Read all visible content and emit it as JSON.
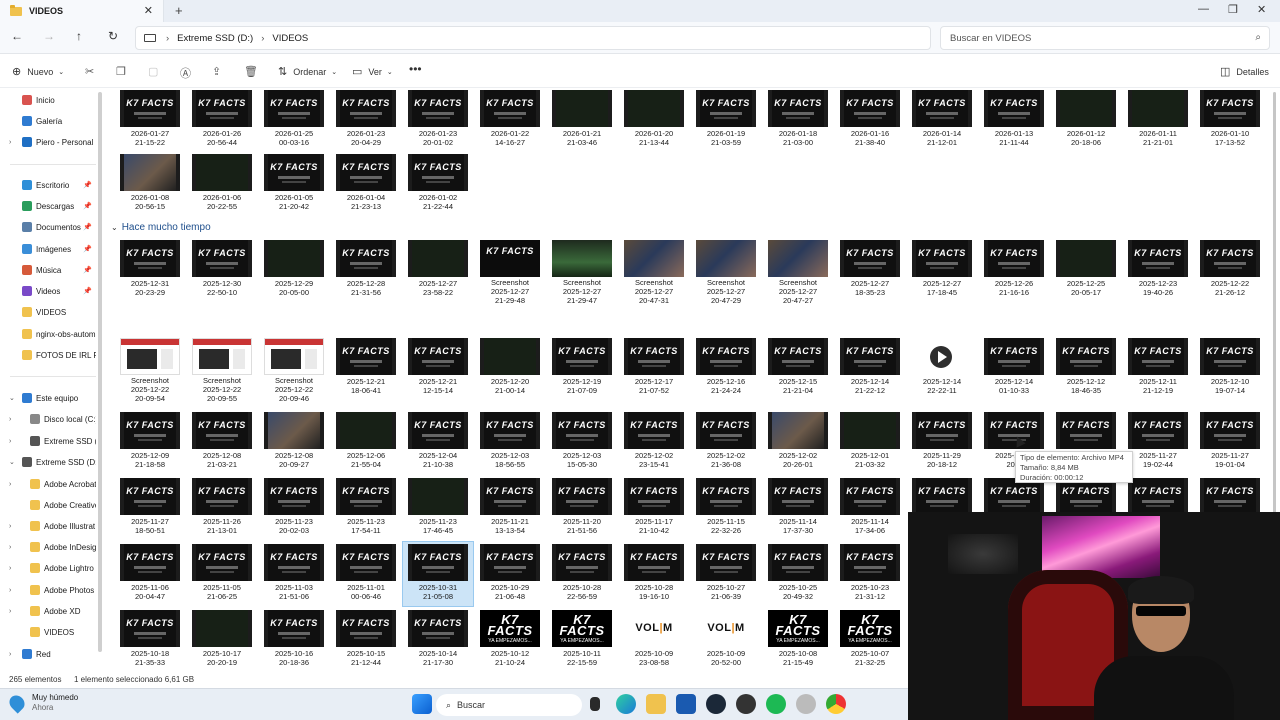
{
  "tab": {
    "title": "VIDEOS"
  },
  "nav": {
    "breadcrumb": [
      "Extreme SSD (D:)",
      "VIDEOS"
    ],
    "search_placeholder": "Buscar en VIDEOS"
  },
  "toolbar": {
    "new_label": "Nuevo",
    "sort_label": "Ordenar",
    "view_label": "Ver",
    "details_label": "Detalles"
  },
  "sidebar": {
    "items": [
      {
        "label": "Inicio",
        "icon": "home-icon",
        "color": "#d9534f"
      },
      {
        "label": "Galería",
        "icon": "gallery-icon",
        "color": "#2f7bd1"
      },
      {
        "label": "Piero - Personal",
        "icon": "cloud-icon",
        "color": "#1f6fc4"
      },
      {
        "label": "Escritorio",
        "icon": "desktop-icon",
        "color": "#2f8fd8"
      },
      {
        "label": "Descargas",
        "icon": "download-icon",
        "color": "#2a9d5c"
      },
      {
        "label": "Documentos",
        "icon": "documents-icon",
        "color": "#5a7fa8"
      },
      {
        "label": "Imágenes",
        "icon": "images-icon",
        "color": "#3a8ed8"
      },
      {
        "label": "Música",
        "icon": "music-icon",
        "color": "#d65a3a"
      },
      {
        "label": "Videos",
        "icon": "videos-icon",
        "color": "#7a4ac8"
      },
      {
        "label": "VIDEOS",
        "icon": "folder-icon",
        "color": "#f0c24e"
      },
      {
        "label": "nginx-obs-autom",
        "icon": "folder-icon",
        "color": "#f0c24e"
      },
      {
        "label": "FOTOS DE IRL PC",
        "icon": "folder-icon",
        "color": "#f0c24e"
      },
      {
        "label": "Este equipo",
        "icon": "pc-icon",
        "color": "#2f7bd1"
      },
      {
        "label": "Disco local (C:)",
        "icon": "drive-icon",
        "color": "#888888"
      },
      {
        "label": "Extreme SSD (D:)",
        "icon": "drive-icon",
        "color": "#555555"
      },
      {
        "label": "Extreme SSD (D:)",
        "icon": "drive-icon",
        "color": "#555555"
      },
      {
        "label": "Adobe Acrobat",
        "icon": "folder-icon",
        "color": "#f0c24e"
      },
      {
        "label": "Adobe Creative",
        "icon": "folder-icon",
        "color": "#f0c24e"
      },
      {
        "label": "Adobe Illustrat",
        "icon": "folder-icon",
        "color": "#f0c24e"
      },
      {
        "label": "Adobe InDesig",
        "icon": "folder-icon",
        "color": "#f0c24e"
      },
      {
        "label": "Adobe Lightro",
        "icon": "folder-icon",
        "color": "#f0c24e"
      },
      {
        "label": "Adobe Photos",
        "icon": "folder-icon",
        "color": "#f0c24e"
      },
      {
        "label": "Adobe XD",
        "icon": "folder-icon",
        "color": "#f0c24e"
      },
      {
        "label": "VIDEOS",
        "icon": "folder-icon",
        "color": "#f0c24e"
      },
      {
        "label": "Red",
        "icon": "network-icon",
        "color": "#2f7bd1"
      }
    ]
  },
  "group_label": "Hace mucho tiempo",
  "tooltip": {
    "type": "Tipo de elemento: Archivo MP4",
    "size": "Tamaño: 8,84 MB",
    "duration": "Duración: 00:00:12"
  },
  "status": {
    "count": "265 elementos",
    "selection": "1 elemento seleccionado  6,61 GB"
  },
  "taskbar": {
    "weather": "Muy húmedo",
    "weather_sub": "Ahora",
    "search": "Buscar"
  },
  "rows": [
    [
      [
        "2026-01-27",
        "21-15-22",
        "fact"
      ],
      [
        "2026-01-26",
        "20-56-44",
        "fact"
      ],
      [
        "2026-01-25",
        "00-03-16",
        "fact"
      ],
      [
        "2026-01-23",
        "20-04-29",
        "fact"
      ],
      [
        "2026-01-23",
        "20-01-02",
        "fact"
      ],
      [
        "2026-01-22",
        "14-16-27",
        "fact"
      ],
      [
        "2026-01-21",
        "21-03-46",
        "dark"
      ],
      [
        "2026-01-20",
        "21-13-44",
        "dark"
      ],
      [
        "2026-01-19",
        "21-03-59",
        "fact"
      ],
      [
        "2026-01-18",
        "21-03-00",
        "fact"
      ],
      [
        "2026-01-16",
        "21-38-40",
        "fact"
      ],
      [
        "2026-01-14",
        "21-12-01",
        "fact"
      ],
      [
        "2026-01-13",
        "21-11-44",
        "fact"
      ],
      [
        "2026-01-12",
        "20-18-06",
        "dark"
      ],
      [
        "2026-01-11",
        "21-21-01",
        "dark"
      ],
      [
        "2026-01-10",
        "17-13-52",
        "fact"
      ]
    ],
    [
      [
        "2026-01-08",
        "20-56-15",
        "person"
      ],
      [
        "2026-01-06",
        "20-22-55",
        "dark"
      ],
      [
        "2026-01-05",
        "21-20-42",
        "fact"
      ],
      [
        "2026-01-04",
        "21-23-13",
        "fact"
      ],
      [
        "2026-01-02",
        "21-22-44",
        "fact"
      ]
    ],
    [
      [
        "2025-12-31",
        "20-23-29",
        "fact"
      ],
      [
        "2025-12-30",
        "22-50-10",
        "fact"
      ],
      [
        "2025-12-29",
        "20-05-00",
        "dark"
      ],
      [
        "2025-12-28",
        "21-31-56",
        "fact"
      ],
      [
        "2025-12-27",
        "23-58-22",
        "dark"
      ],
      [
        "Screenshot",
        "2025-12-27",
        "shot",
        "21-29-48"
      ],
      [
        "Screenshot",
        "2025-12-27",
        "green",
        "21-29-47"
      ],
      [
        "Screenshot",
        "2025-12-27",
        "crowd",
        "20-47-31"
      ],
      [
        "Screenshot",
        "2025-12-27",
        "crowd",
        "20-47-29"
      ],
      [
        "Screenshot",
        "2025-12-27",
        "crowd",
        "20-47-27"
      ],
      [
        "2025-12-27",
        "18-35-23",
        "fact"
      ],
      [
        "2025-12-27",
        "17-18-45",
        "fact"
      ],
      [
        "2025-12-26",
        "21-16-16",
        "fact"
      ],
      [
        "2025-12-25",
        "20-05-17",
        "dark"
      ],
      [
        "2025-12-23",
        "19-40-26",
        "fact"
      ],
      [
        "2025-12-22",
        "21-26-12",
        "fact"
      ]
    ],
    [
      [
        "Screenshot",
        "2025-12-22",
        "ss",
        "20-09-54"
      ],
      [
        "Screenshot",
        "2025-12-22",
        "ss",
        "20-09-55"
      ],
      [
        "Screenshot",
        "2025-12-22",
        "ss",
        "20-09-46"
      ],
      [
        "2025-12-21",
        "18-06-41",
        "fact"
      ],
      [
        "2025-12-21",
        "12-15-14",
        "fact"
      ],
      [
        "2025-12-20",
        "21-00-14",
        "dark"
      ],
      [
        "2025-12-19",
        "21-07-09",
        "fact"
      ],
      [
        "2025-12-17",
        "21-07-52",
        "fact"
      ],
      [
        "2025-12-16",
        "21-24-24",
        "fact"
      ],
      [
        "2025-12-15",
        "21-21-04",
        "fact"
      ],
      [
        "2025-12-14",
        "21-22-12",
        "fact"
      ],
      [
        "2025-12-14",
        "22-22-11",
        "mp4"
      ],
      [
        "2025-12-14",
        "01-10-33",
        "fact"
      ],
      [
        "2025-12-12",
        "18-46-35",
        "fact"
      ],
      [
        "2025-12-11",
        "21-12-19",
        "fact"
      ],
      [
        "2025-12-10",
        "19-07-14",
        "fact"
      ]
    ],
    [
      [
        "2025-12-09",
        "21-18-58",
        "fact"
      ],
      [
        "2025-12-08",
        "21-03-21",
        "fact"
      ],
      [
        "2025-12-08",
        "20-09-27",
        "person"
      ],
      [
        "2025-12-06",
        "21-55-04",
        "dark"
      ],
      [
        "2025-12-04",
        "21-10-38",
        "fact"
      ],
      [
        "2025-12-03",
        "18-56-55",
        "fact"
      ],
      [
        "2025-12-03",
        "15-05-30",
        "fact"
      ],
      [
        "2025-12-02",
        "23-15-41",
        "fact"
      ],
      [
        "2025-12-02",
        "21-36-08",
        "fact"
      ],
      [
        "2025-12-02",
        "20-26-01",
        "person"
      ],
      [
        "2025-12-01",
        "21-03-32",
        "dark"
      ],
      [
        "2025-11-29",
        "20-18-12",
        "fact"
      ],
      [
        "2025-11-28",
        "20-1",
        "fact"
      ],
      [
        "2025-11-28",
        "21-11-02",
        "fact"
      ],
      [
        "2025-11-27",
        "19-02-44",
        "fact"
      ],
      [
        "2025-11-27",
        "19-01-04",
        "fact"
      ]
    ],
    [
      [
        "2025-11-27",
        "18-50-51",
        "fact"
      ],
      [
        "2025-11-26",
        "21-13-01",
        "fact"
      ],
      [
        "2025-11-23",
        "20-02-03",
        "fact"
      ],
      [
        "2025-11-23",
        "17-54-11",
        "fact"
      ],
      [
        "2025-11-23",
        "17-46-45",
        "dark"
      ],
      [
        "2025-11-21",
        "13-13-54",
        "fact"
      ],
      [
        "2025-11-20",
        "21-51-56",
        "fact"
      ],
      [
        "2025-11-17",
        "21-10-42",
        "fact"
      ],
      [
        "2025-11-15",
        "22-32-26",
        "fact"
      ],
      [
        "2025-11-14",
        "17-37-30",
        "fact"
      ],
      [
        "2025-11-14",
        "17-34-06",
        "fact"
      ],
      [
        "",
        "",
        "fact"
      ],
      [
        "",
        "",
        "fact"
      ],
      [
        "",
        "",
        "fact"
      ],
      [
        "",
        "",
        "fact"
      ],
      [
        "",
        "",
        "fact"
      ]
    ],
    [
      [
        "2025-11-06",
        "20-04-47",
        "fact"
      ],
      [
        "2025-11-05",
        "21-06-25",
        "fact"
      ],
      [
        "2025-11-03",
        "21-51-06",
        "fact"
      ],
      [
        "2025-11-01",
        "00-06-46",
        "fact"
      ],
      [
        "2025-10-31",
        "21-05-08",
        "fact"
      ],
      [
        "2025-10-29",
        "21-06-48",
        "fact"
      ],
      [
        "2025-10-28",
        "22-56-59",
        "fact"
      ],
      [
        "2025-10-28",
        "19-16-10",
        "fact"
      ],
      [
        "2025-10-27",
        "21-06-39",
        "fact"
      ],
      [
        "2025-10-25",
        "20-49-32",
        "fact"
      ],
      [
        "2025-10-23",
        "21-31-12",
        "fact"
      ]
    ],
    [
      [
        "2025-10-18",
        "21-35-33",
        "fact"
      ],
      [
        "2025-10-17",
        "20-20-19",
        "dark"
      ],
      [
        "2025-10-16",
        "20-18-36",
        "fact"
      ],
      [
        "2025-10-15",
        "21-12-44",
        "fact"
      ],
      [
        "2025-10-14",
        "21-17-30",
        "fact"
      ],
      [
        "2025-10-12",
        "21-10-24",
        "k7"
      ],
      [
        "2025-10-11",
        "22-15-59",
        "k7"
      ],
      [
        "2025-10-09",
        "23-08-58",
        "vol"
      ],
      [
        "2025-10-09",
        "20-52-00",
        "vol"
      ],
      [
        "2025-10-08",
        "21-15-49",
        "k7"
      ],
      [
        "2025-10-07",
        "21-32-25",
        "k7"
      ]
    ]
  ]
}
